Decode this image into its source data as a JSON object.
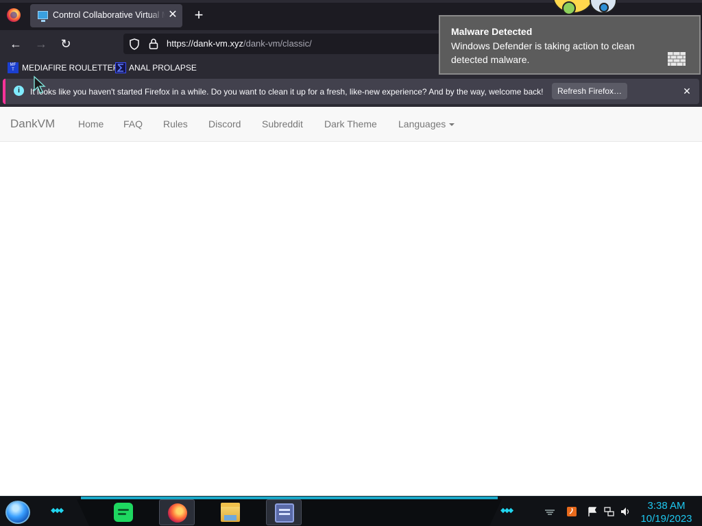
{
  "browser": {
    "tab_title": "Control Collaborative Virtual Machines",
    "tab_close": "✕",
    "new_tab": "+",
    "nav": {
      "back": "←",
      "forward": "→",
      "reload": "↻"
    },
    "url": {
      "host": "https://dank-vm.xyz",
      "path": "/dank-vm/classic/"
    },
    "bookmarks": [
      {
        "label": "MEDIAFIRE ROULETTER",
        "icon": "mediafire-icon"
      },
      {
        "label": "ANAL PROLAPSE",
        "icon": "sigma-icon"
      }
    ],
    "notification": {
      "message": "It looks like you haven't started Firefox in a while. Do you want to clean it up for a fresh, like-new experience? And by the way, welcome back!",
      "button": "Refresh Firefox…",
      "close": "✕"
    }
  },
  "site": {
    "brand": "DankVM",
    "links": [
      "Home",
      "FAQ",
      "Rules",
      "Discord",
      "Subreddit",
      "Dark Theme",
      "Languages"
    ]
  },
  "toast": {
    "title": "Malware Detected",
    "body": "Windows Defender is taking action to clean detected malware."
  },
  "taskbar": {
    "time": "3:38 AM",
    "date": "10/19/2023",
    "apps": [
      "spotify-icon",
      "firefox-icon",
      "file-explorer-icon",
      "remote-desktop-icon"
    ],
    "accent": "#1ec8f0"
  },
  "colors": {
    "chrome_dark": "#1c1b22",
    "chrome_toolbar": "#2b2a33",
    "notification_accent": "#ff3399",
    "site_nav_bg": "#f8f8f8",
    "toast_bg": "#5c5c5c"
  }
}
